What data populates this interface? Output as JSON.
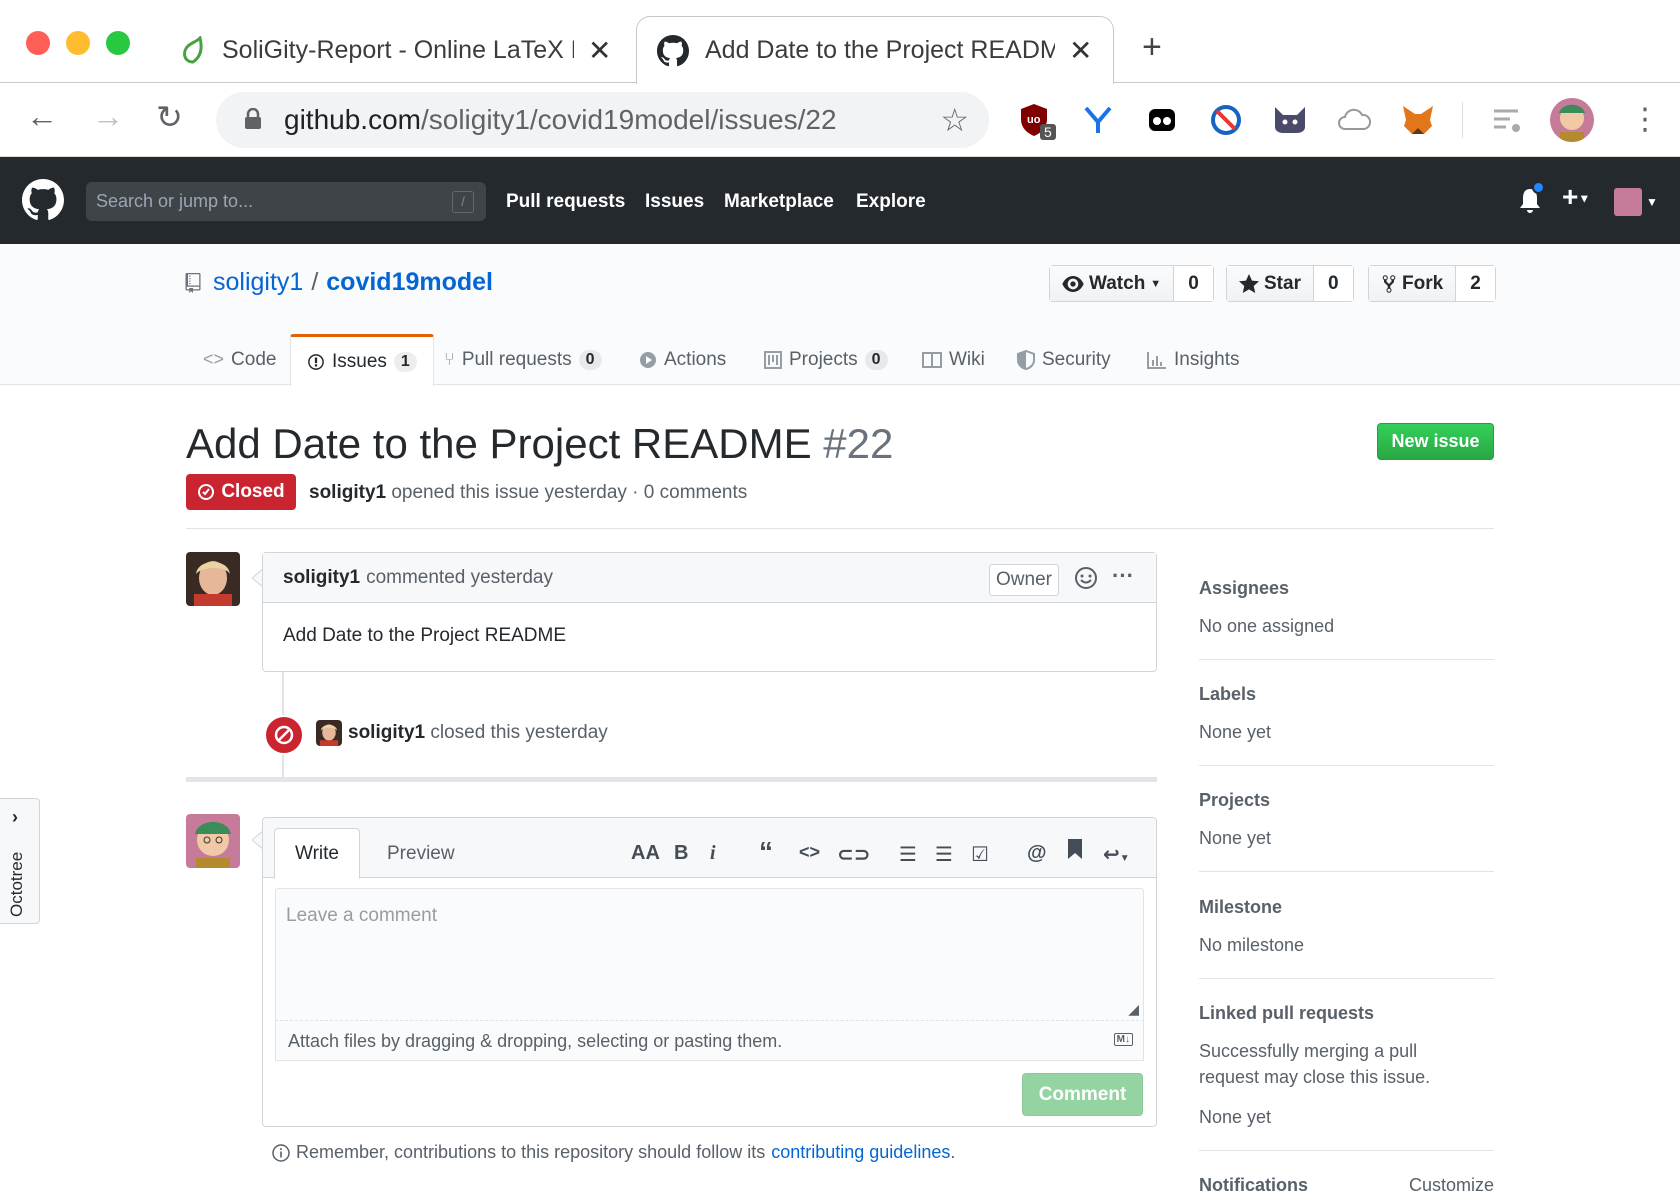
{
  "browser": {
    "tabs": [
      {
        "title": "SoliGity-Report - Online LaTeX Ed",
        "close": "✕"
      },
      {
        "title": "Add Date to the Project README",
        "close": "✕"
      }
    ],
    "url_host": "github.com",
    "url_path": "/soligity1/covid19model/issues/22",
    "extension_badge": "5",
    "colors": {
      "close": "#ff5f57",
      "minimize": "#febc2e",
      "zoom": "#28c840"
    }
  },
  "gh_header": {
    "search_placeholder": "Search or jump to...",
    "slash": "/",
    "nav": [
      "Pull requests",
      "Issues",
      "Marketplace",
      "Explore"
    ]
  },
  "repo": {
    "owner": "soligity1",
    "name": "covid19model",
    "watch_label": "Watch",
    "watch_count": "0",
    "star_label": "Star",
    "star_count": "0",
    "fork_label": "Fork",
    "fork_count": "2",
    "tabs": [
      {
        "label": "Code"
      },
      {
        "label": "Issues",
        "count": "1"
      },
      {
        "label": "Pull requests",
        "count": "0"
      },
      {
        "label": "Actions"
      },
      {
        "label": "Projects",
        "count": "0"
      },
      {
        "label": "Wiki"
      },
      {
        "label": "Security"
      },
      {
        "label": "Insights"
      }
    ]
  },
  "issue": {
    "title": "Add Date to the Project README",
    "number": "#22",
    "new_issue_label": "New issue",
    "state": "Closed",
    "author": "soligity1",
    "meta": "opened this issue yesterday · 0 comments",
    "comment": {
      "author": "soligity1",
      "time": "commented yesterday",
      "role": "Owner",
      "body": "Add Date to the Project README"
    },
    "event": {
      "actor": "soligity1",
      "text": "closed this yesterday"
    }
  },
  "composer": {
    "write_tab": "Write",
    "preview_tab": "Preview",
    "placeholder": "Leave a comment",
    "attach_text": "Attach files by dragging & dropping, selecting or pasting them.",
    "submit_label": "Comment",
    "remember_text": "Remember, contributions to this repository should follow its",
    "guidelines_link": "contributing guidelines",
    "period": "."
  },
  "sidebar": {
    "assignees": {
      "heading": "Assignees",
      "value": "No one assigned"
    },
    "labels": {
      "heading": "Labels",
      "value": "None yet"
    },
    "projects": {
      "heading": "Projects",
      "value": "None yet"
    },
    "milestone": {
      "heading": "Milestone",
      "value": "No milestone"
    },
    "linked_prs": {
      "heading": "Linked pull requests",
      "description": "Successfully merging a pull request may close this issue.",
      "value": "None yet"
    },
    "notifications": {
      "heading": "Notifications",
      "action": "Customize"
    }
  },
  "octotree": {
    "label": "Octotree"
  }
}
